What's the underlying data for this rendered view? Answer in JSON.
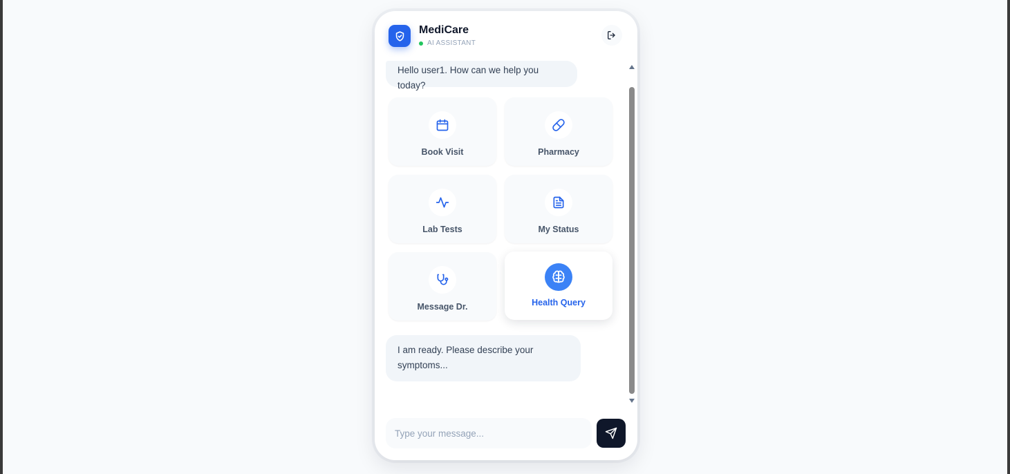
{
  "header": {
    "title": "MediCare",
    "status": "AI ASSISTANT"
  },
  "messages": [
    "Hello user1. How can we help you today?",
    "I am ready. Please describe your symptoms..."
  ],
  "actions": [
    {
      "label": "Book Visit",
      "icon": "calendar-icon"
    },
    {
      "label": "Pharmacy",
      "icon": "pill-icon"
    },
    {
      "label": "Lab Tests",
      "icon": "activity-icon"
    },
    {
      "label": "My Status",
      "icon": "file-text-icon"
    },
    {
      "label": "Message Dr.",
      "icon": "stethoscope-icon"
    },
    {
      "label": "Health Query",
      "icon": "brain-icon",
      "active": true
    }
  ],
  "input": {
    "placeholder": "Type your message...",
    "value": ""
  },
  "colors": {
    "accent": "#2563eb",
    "accent_light": "#3b82f6",
    "online": "#22c55e",
    "send_button": "#0f172a"
  }
}
